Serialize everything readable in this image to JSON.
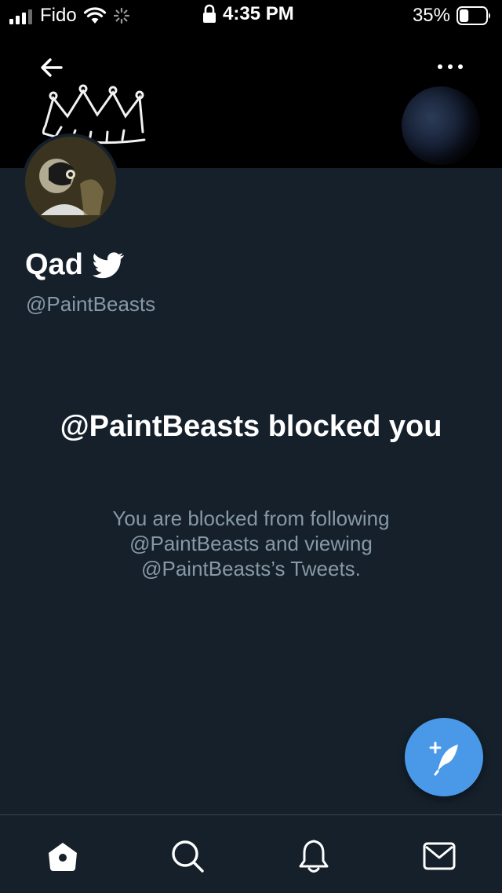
{
  "status_bar": {
    "carrier": "Fido",
    "time": "4:35 PM",
    "battery_percent": "35%",
    "battery_level": 0.35,
    "icons": [
      "signal-icon",
      "wifi-icon",
      "activity-spinner-icon",
      "lock-icon",
      "battery-icon"
    ]
  },
  "header": {
    "back_icon": "back-arrow-icon",
    "more_icon": "more-dots-icon"
  },
  "profile": {
    "display_name": "Qad",
    "handle": "@PaintBeasts",
    "brand_icon": "twitter-bird-icon"
  },
  "blocked": {
    "title": "@PaintBeasts blocked you",
    "description": "You are blocked from following @PaintBeasts and viewing @PaintBeasts’s Tweets."
  },
  "fab": {
    "icon": "compose-tweet-icon"
  },
  "bottom_nav": {
    "items": [
      "home-icon",
      "search-icon",
      "notifications-icon",
      "messages-icon"
    ]
  },
  "colors": {
    "background": "#15202b",
    "secondary_text": "#8899a6",
    "accent": "#4a99e9",
    "divider": "#38444d"
  }
}
